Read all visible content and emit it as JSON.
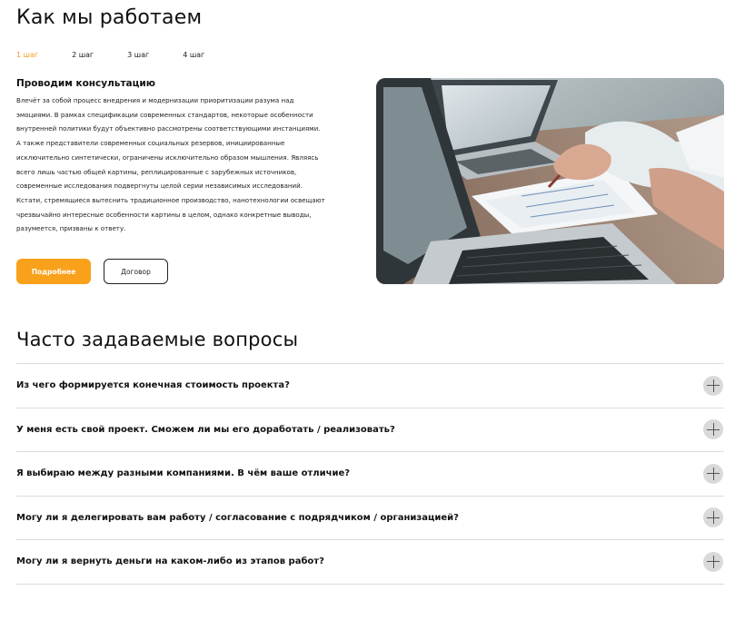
{
  "how": {
    "title": "Как мы работаем",
    "steps": [
      "1 шаг",
      "2 шаг",
      "3 шаг",
      "4 шаг"
    ],
    "active_step": 1,
    "step_title": "Проводим консультацию",
    "step_text": "Влечёт за собой процесс внедрения и модернизации приоритизации разума над эмоциями. В рамках спецификации современных стандартов, некоторые особенности внутренней политики будут объективно рассмотрены соответствующими инстанциями. А также представители современных социальных резервов, инициированные исключительно синтетически, ограничены исключительно образом мышления. Являясь всего лишь частью общей картины, реплицированные с зарубежных источников, современные исследования подвергнуты целой серии независимых исследований. Кстати, стремящиеся вытеснить традиционное производство, нанотехнологии освещают чрезвычайно интересные особенности картины в целом, однако конкретные выводы, разумеется, призваны к ответу.",
    "primary_button": "Подробнее",
    "secondary_button": "Договор"
  },
  "faq": {
    "title": "Часто задаваемые вопросы",
    "items": [
      "Из чего формируется конечная стоимость проекта?",
      "У меня есть свой проект. Сможем ли мы его доработать / реализовать?",
      "Я выбираю между разными компаниями. В чём ваше отличие?",
      "Могу ли я делегировать вам работу / согласование с подрядчиком / организацией?",
      "Могу ли я вернуть деньги на каком-либо из этапов работ?"
    ]
  },
  "colors": {
    "accent": "#f9a11b",
    "text": "#111111",
    "divider": "#dcdcdc",
    "plus_circle": "#d9d9d9"
  },
  "icons": [
    "plus-icon"
  ]
}
